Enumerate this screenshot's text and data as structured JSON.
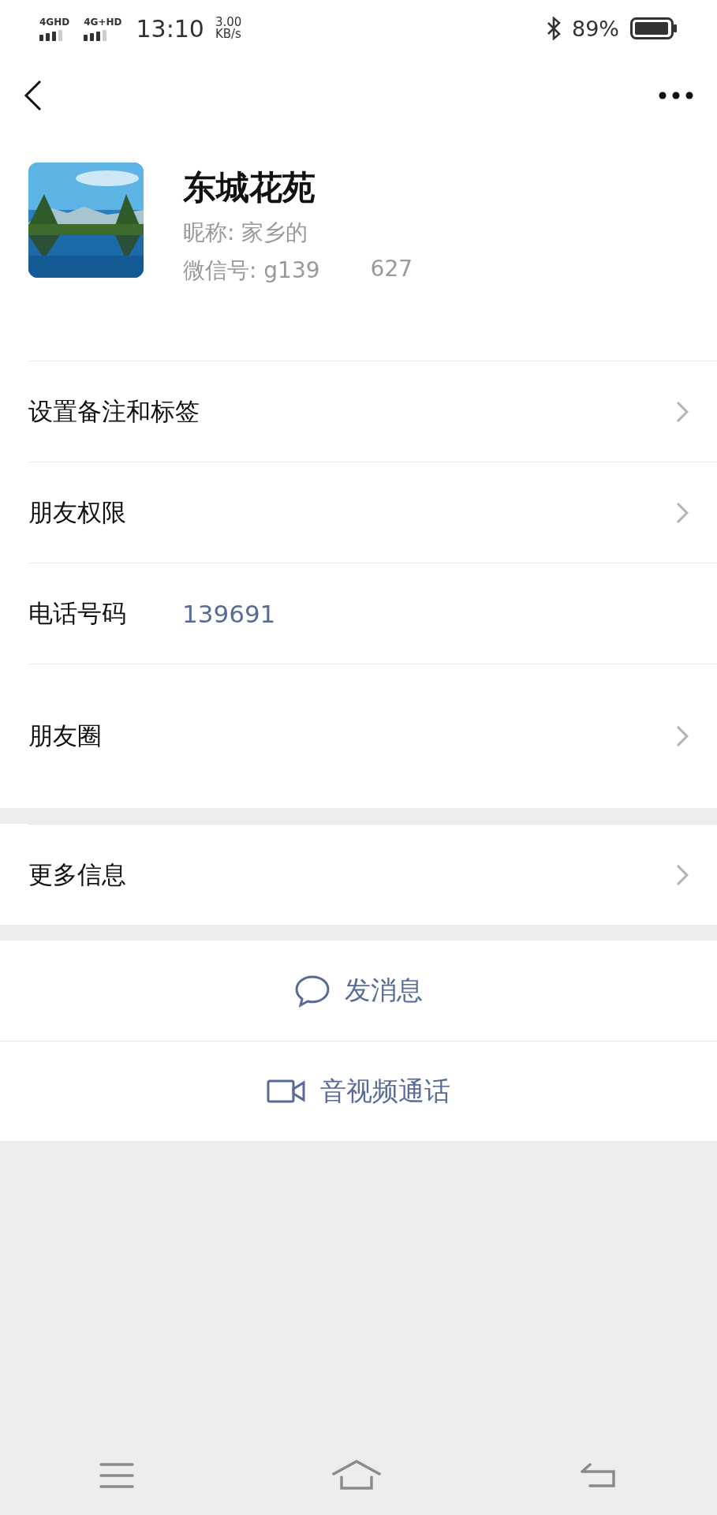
{
  "status_bar": {
    "networks": [
      "4GHD",
      "4G+HD"
    ],
    "time": "13:10",
    "speed": "3.00",
    "speed_unit": "KB/s",
    "battery": "89%"
  },
  "profile": {
    "name": "东城花苑",
    "nickname": "昵称: 家乡的",
    "wechat_id_start": "微信号: g139",
    "wechat_id_end": "627"
  },
  "sections": [
    {
      "items": [
        {
          "kind": "link",
          "label": "设置备注和标签"
        },
        {
          "kind": "link",
          "label": "朋友权限"
        },
        {
          "kind": "value",
          "label": "电话号码",
          "value": "139691"
        },
        {
          "kind": "album",
          "label": "朋友圈"
        }
      ]
    },
    {
      "items": [
        {
          "kind": "link",
          "label": "更多信息"
        }
      ]
    }
  ],
  "actions": [
    {
      "kind": "message",
      "label": "发消息"
    },
    {
      "kind": "video",
      "label": "音视频通话"
    }
  ]
}
